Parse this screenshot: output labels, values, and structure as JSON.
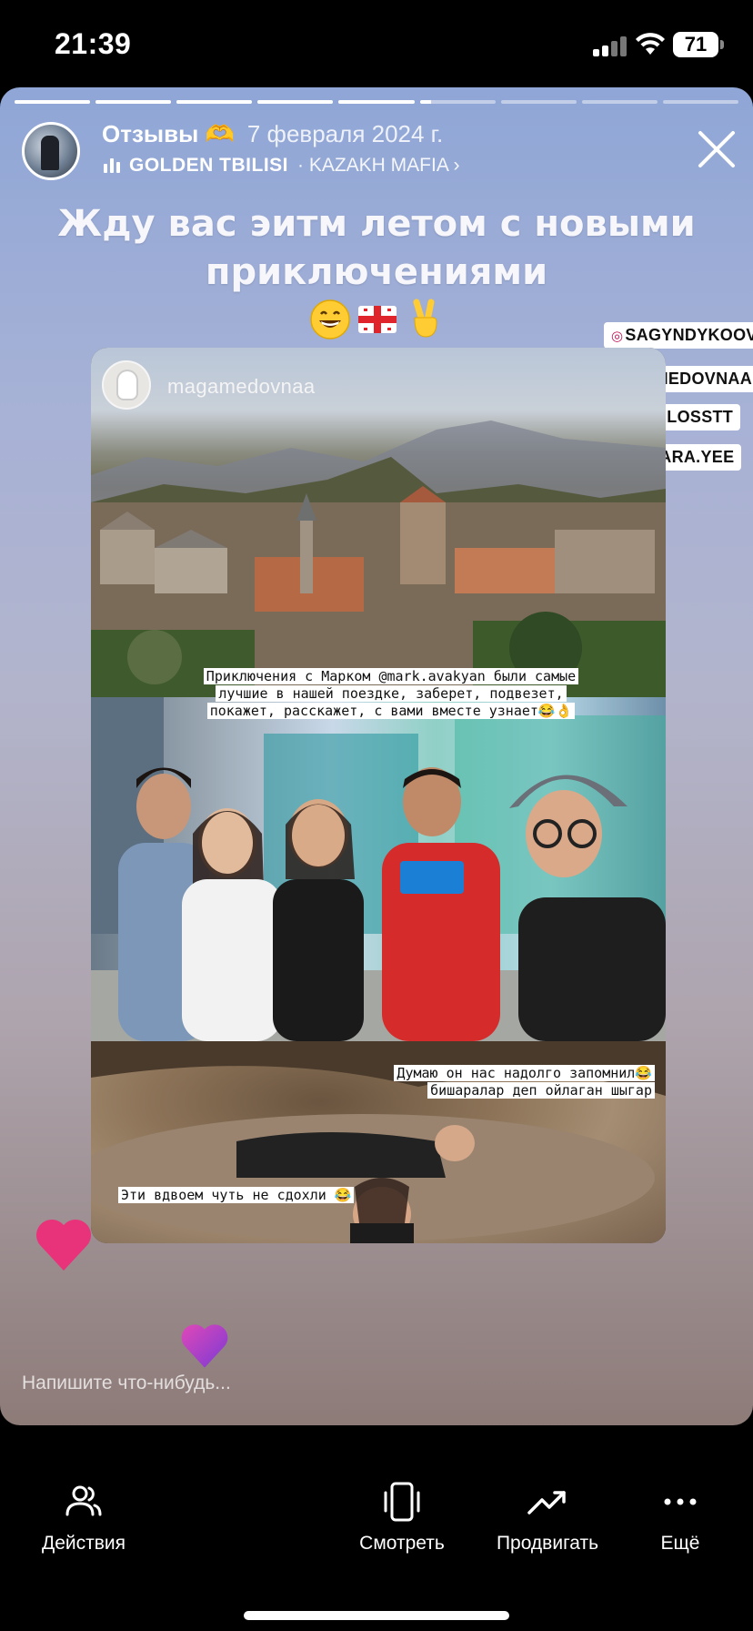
{
  "status_bar": {
    "time": "21:39",
    "battery": "71"
  },
  "story": {
    "progress": [
      1,
      1,
      1,
      1,
      1,
      0.15,
      0,
      0,
      0
    ],
    "title": "Отзывы 🫶",
    "date": "7 февраля 2024 г.",
    "music": {
      "track": "GOLDEN TBILISI",
      "artist": "· KAZAKH MAFIA ›"
    },
    "caption": "Жду вас эитм летом с новыми приключениями",
    "emojis": [
      "grinning-face",
      "georgia-flag",
      "victory-hand"
    ],
    "mentions": [
      "SAGYNDYKOOVV",
      "MAGAMEDOVNAA",
      "LIILOSSTT",
      "DINARA.YEE"
    ],
    "post_username": "magamedovnaa",
    "caption_adventure": "Приключения с Марком @mark.avakyan были самые лучшие в нашей поездке, заберет, подвезет, покажет, расскажет, с вами вместе узнает😂👌",
    "caption_remember": "Думаю он нас надолго запомнил😂 бишаралар деп ойлаган шыгар",
    "caption_two": "Эти вдвоем чуть не сдохли 😂",
    "reply_placeholder": "Напишите что-нибудь..."
  },
  "bottom_actions": [
    {
      "icon": "people-icon",
      "label": "Действия"
    },
    {
      "icon": "phone-view-icon",
      "label": "Смотреть"
    },
    {
      "icon": "trending-up-icon",
      "label": "Продвигать"
    },
    {
      "icon": "more-icon",
      "label": "Ещё"
    }
  ],
  "colors": {
    "accent_pink": "#e8337a",
    "heart_purple": "#a33bd6",
    "story_bg_top": "#8fa6d6",
    "story_bg_bottom": "#8d7b78"
  }
}
